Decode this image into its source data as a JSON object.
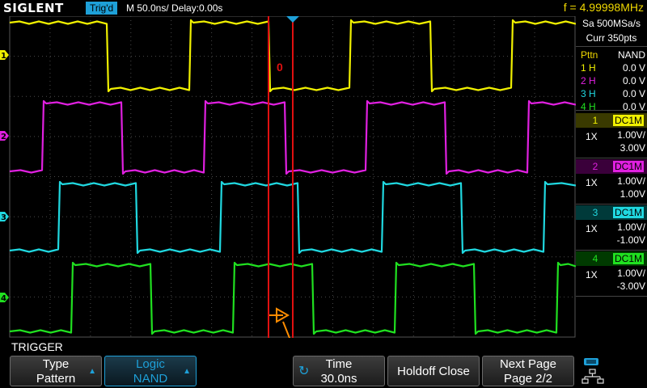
{
  "header": {
    "brand": "SIGLENT",
    "trigger_status": "Trig'd",
    "timebase": "M 50.0ns/",
    "delay": "Delay:0.00s",
    "frequency": "f = 4.99998MHz"
  },
  "acquisition": {
    "sample_rate": "Sa 500MSa/s",
    "memory": "Curr 350pts"
  },
  "pattern": {
    "title": "Pttn",
    "logic": "NAND",
    "rows": [
      {
        "label": "1 H",
        "value": "0.0 V",
        "color": "#f0f000"
      },
      {
        "label": "2 H",
        "value": "0.0 V",
        "color": "#e020e0"
      },
      {
        "label": "3 H",
        "value": "0.0 V",
        "color": "#20d8e0"
      },
      {
        "label": "4 H",
        "value": "0.0 V",
        "color": "#20e020"
      }
    ]
  },
  "channels": [
    {
      "num": "1",
      "coupling": "DC1M",
      "probe": "1X",
      "scale": "1.00V/",
      "offset": "3.00V",
      "color": "#f0f000",
      "marker": "1"
    },
    {
      "num": "2",
      "coupling": "DC1M",
      "probe": "1X",
      "scale": "1.00V/",
      "offset": "1.00V",
      "color": "#e020e0",
      "marker": "2"
    },
    {
      "num": "3",
      "coupling": "DC1M",
      "probe": "1X",
      "scale": "1.00V/",
      "offset": "-1.00V",
      "color": "#20d8e0",
      "marker": "3"
    },
    {
      "num": "4",
      "coupling": "DC1M",
      "probe": "1X",
      "scale": "1.00V/",
      "offset": "-3.00V",
      "color": "#20e020",
      "marker": "4"
    }
  ],
  "display": {
    "cursor_label": "0",
    "accent_color": "#1ea0d8",
    "cursor_color": "#e01010",
    "trigger_marker_color": "#ff8c00"
  },
  "menu": {
    "title": "TRIGGER",
    "softkeys": [
      {
        "line1": "Type",
        "line2": "Pattern"
      },
      {
        "line1": "Logic",
        "line2": "NAND"
      },
      {
        "line1": "Time",
        "line2": "30.0ns"
      },
      {
        "line1": "Holdoff Close"
      },
      {
        "line1": "Next Page",
        "line2": "Page 2/2"
      }
    ]
  },
  "icons": {
    "network": "network-icon",
    "usb": "usb-icon",
    "knob": "rotate-knob-icon"
  }
}
